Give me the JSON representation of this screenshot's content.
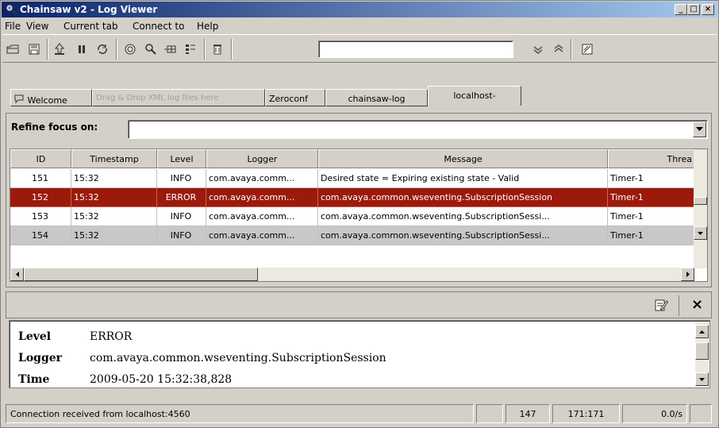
{
  "window": {
    "title": "Chainsaw v2 - Log Viewer",
    "controls": {
      "minimize": "_",
      "maximize": "□",
      "close": "×"
    }
  },
  "menu": [
    {
      "label": "File"
    },
    {
      "label": "View"
    },
    {
      "label": "Current tab"
    },
    {
      "label": "Connect to"
    },
    {
      "label": "Help"
    }
  ],
  "toolbar": {
    "icons": [
      "open-icon",
      "save-icon",
      "undock-icon",
      "pause-icon",
      "refresh-icon",
      "toggle-detail-icon",
      "find-icon",
      "scroll-to-bottom-icon",
      "columns-icon",
      "clear-icon",
      "find-next-icon",
      "find-previous-icon",
      "close-tab-icon"
    ],
    "find_value": ""
  },
  "tabs": [
    {
      "label": "Welcome",
      "disabled": false
    },
    {
      "label": "Drag & Drop XML log files here",
      "disabled": true
    },
    {
      "label": "Zeroconf",
      "disabled": false
    },
    {
      "label": "chainsaw-log",
      "disabled": false
    },
    {
      "label": "localhost-",
      "disabled": false,
      "active": true
    }
  ],
  "refine": {
    "label": "Refine focus on:",
    "value": ""
  },
  "table": {
    "columns": [
      "ID",
      "Timestamp",
      "Level",
      "Logger",
      "Message",
      "Threa"
    ],
    "rows": [
      {
        "id": "151",
        "timestamp": "15:32",
        "level": "INFO",
        "logger": "com.avaya.comm...",
        "message": "Desired state = Expiring existing state - Valid",
        "thread": "Timer-1"
      },
      {
        "id": "152",
        "timestamp": "15:32",
        "level": "ERROR",
        "logger": "com.avaya.comm...",
        "message": "com.avaya.common.wseventing.SubscriptionSession",
        "thread": "Timer-1"
      },
      {
        "id": "153",
        "timestamp": "15:32",
        "level": "INFO",
        "logger": "com.avaya.comm...",
        "message": "com.avaya.common.wseventing.SubscriptionSessi...",
        "thread": "Timer-1"
      },
      {
        "id": "154",
        "timestamp": "15:32",
        "level": "INFO",
        "logger": "com.avaya.comm...",
        "message": "com.avaya.common.wseventing.SubscriptionSessi...",
        "thread": "Timer-1"
      }
    ],
    "error_color": "#9b1a0b",
    "selected_color": "#c8c8c8"
  },
  "detail": {
    "fields": [
      {
        "label": "Level",
        "value": "ERROR"
      },
      {
        "label": "Logger",
        "value": "com.avaya.common.wseventing.SubscriptionSession"
      },
      {
        "label": "Time",
        "value": "2009-05-20 15:32:38,828"
      }
    ],
    "close": "×"
  },
  "status": {
    "message": "Connection received from localhost:4560",
    "empty": "",
    "count": "147",
    "range": "171:171",
    "rate": "0.0/s"
  }
}
